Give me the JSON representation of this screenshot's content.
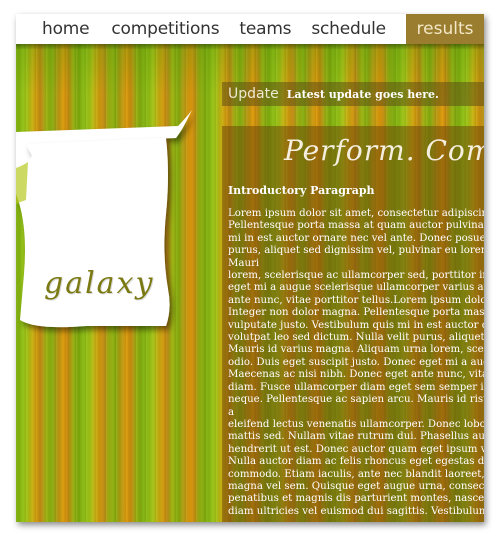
{
  "nav": {
    "items": [
      "home",
      "competitions",
      "teams",
      "schedule"
    ],
    "active": "results"
  },
  "logo": {
    "text": "galaxy"
  },
  "update": {
    "label": "Update",
    "text": "Latest update goes here."
  },
  "hero": {
    "text": "Perform. Compe"
  },
  "intro": {
    "title": "Introductory Paragraph",
    "body": "Lorem ipsum dolor sit amet, consectetur adipiscing elit.\nPellentesque porta massa at quam auctor pulvinar. Sed e\nmi in est auctor ornare nec vel ante. Donec posuere vol\npurus, aliquet sed dignissim vel, pulvinar eu lorem. Mauri\nlorem, scelerisque ac ullamcorper sed, porttitor in odio.\neget mi a augue scelerisque ullamcorper varius at mi. Ma\nante nunc, vitae porttitor tellus.Lorem ipsum dolor sit a\nInteger non dolor magna. Pellentesque porta massa at q\nvulputate justo. Vestibulum quis mi in est auctor ornare\nvolutpat leo sed dictum. Nulla velit purus, aliquet sed dig\nMauris id varius magna. Aliquam urna lorem, scelerisque\nodio. Duis eget suscipit justo. Donec eget mi a augue sc\nMaecenas ac nisi nibh. Donec eget ante nunc, vitae port\ndiam. Fusce ullamcorper diam eget sem semper in portt\nneque. Pellentesque ac sapien arcu. Mauris id risus nisl, a\neleifend lectus venenatis ullamcorper. Donec lobortis co\nmattis sed. Nullam vitae rutrum dui. Phasellus augue era\nhendrerit ut est. Donec auctor quam eget ipsum vehicul\nNulla auctor diam ac felis rhoncus eget egestas dui adipi\ncommodo. Etiam iaculis, ante nec blandit laoreet, ligula c\nmagna vel sem. Quisque eget augue urna, consectetur ve\npenatibus et magnis dis parturient montes, nascetur ridic\ndiam ultricies vel euismod dui sagittis. Vestibulum ullamc"
  }
}
